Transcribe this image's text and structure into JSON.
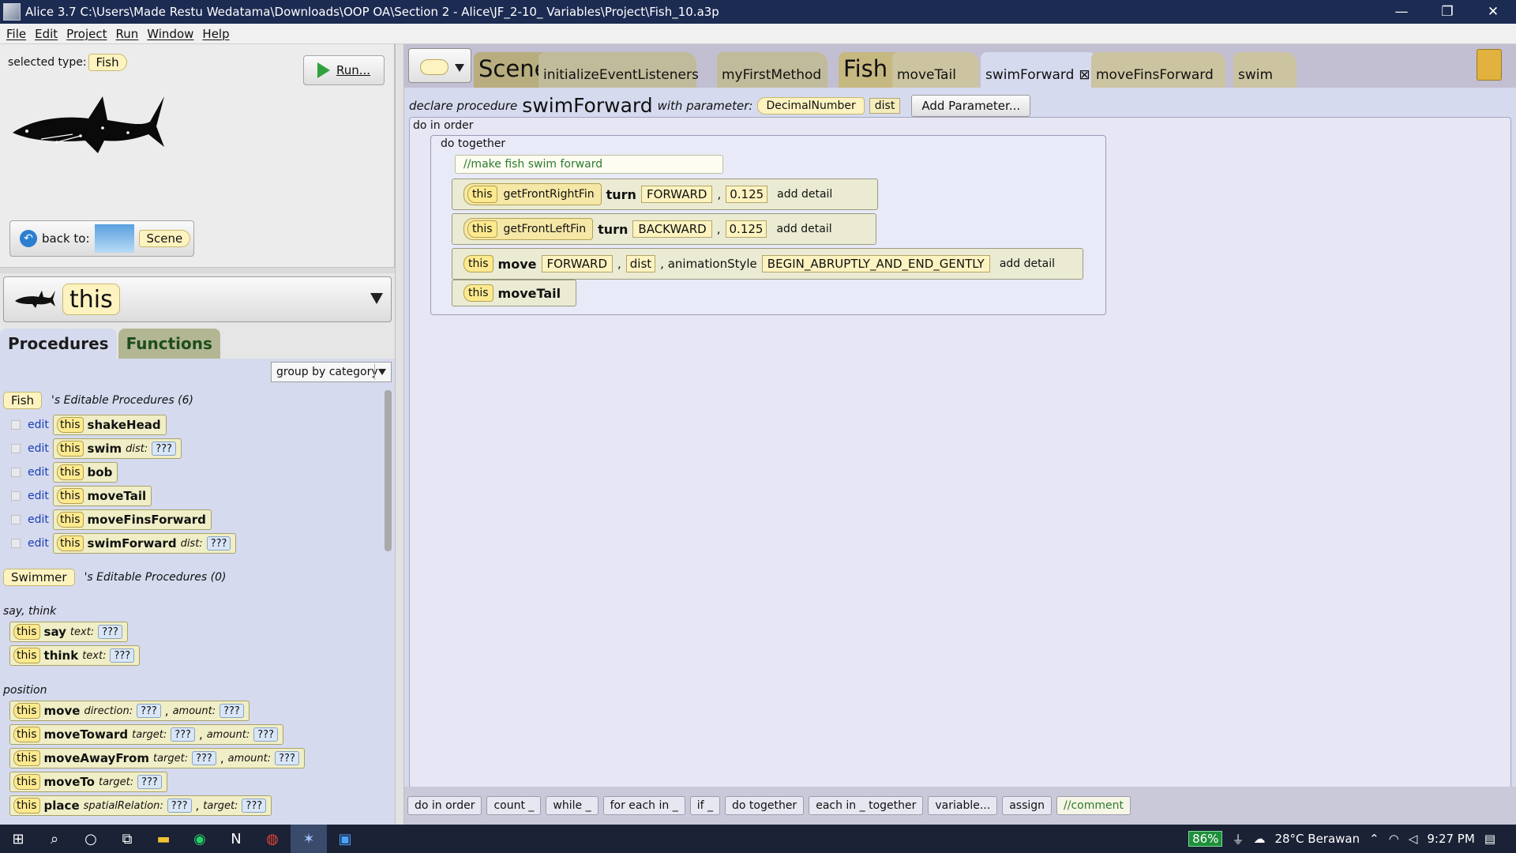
{
  "window": {
    "title": "Alice 3.7 C:\\Users\\Made Restu Wedatama\\Downloads\\OOP OA\\Section 2 - Alice\\JF_2-10_ Variables\\Project\\Fish_10.a3p",
    "min": "—",
    "max": "❐",
    "close": "✕"
  },
  "menu": [
    "File",
    "Edit",
    "Project",
    "Run",
    "Window",
    "Help"
  ],
  "left_top": {
    "selected_type_label": "selected type:",
    "selected_type": "Fish",
    "run_label": "Run...",
    "back_to_label": "back to:",
    "back_to_target": "Scene"
  },
  "instance": {
    "name": "this"
  },
  "left_tabs": {
    "procedures": "Procedures",
    "functions": "Functions"
  },
  "group_by": "group by category",
  "fish_header": {
    "type": "Fish",
    "label": "'s Editable Procedures (6)"
  },
  "fish_procs": [
    {
      "edit": "edit",
      "this": "this",
      "name": "shakeHead"
    },
    {
      "edit": "edit",
      "this": "this",
      "name": "swim",
      "param": "dist:",
      "val": "???"
    },
    {
      "edit": "edit",
      "this": "this",
      "name": "bob"
    },
    {
      "edit": "edit",
      "this": "this",
      "name": "moveTail"
    },
    {
      "edit": "edit",
      "this": "this",
      "name": "moveFinsForward"
    },
    {
      "edit": "edit",
      "this": "this",
      "name": "swimForward",
      "param": "dist:",
      "val": "???"
    }
  ],
  "swimmer_header": {
    "type": "Swimmer",
    "label": "'s Editable Procedures (0)"
  },
  "cat_say": "say, think",
  "say_procs": [
    {
      "this": "this",
      "name": "say",
      "p1": "text:",
      "v1": "???"
    },
    {
      "this": "this",
      "name": "think",
      "p1": "text:",
      "v1": "???"
    }
  ],
  "cat_position": "position",
  "pos_procs": [
    {
      "this": "this",
      "name": "move",
      "p1": "direction:",
      "v1": "???",
      "p2": "amount:",
      "v2": "???"
    },
    {
      "this": "this",
      "name": "moveToward",
      "p1": "target:",
      "v1": "???",
      "p2": "amount:",
      "v2": "???"
    },
    {
      "this": "this",
      "name": "moveAwayFrom",
      "p1": "target:",
      "v1": "???",
      "p2": "amount:",
      "v2": "???"
    },
    {
      "this": "this",
      "name": "moveTo",
      "p1": "target:",
      "v1": "???"
    },
    {
      "this": "this",
      "name": "place",
      "p1": "spatialRelation:",
      "v1": "???",
      "p2": "target:",
      "v2": "???"
    }
  ],
  "tabs": {
    "scene": "Scene",
    "scene_methods": [
      "initializeEventListeners",
      "myFirstMethod"
    ],
    "fish": "Fish",
    "fish_methods": [
      "moveTail",
      "swimForward",
      "moveFinsForward",
      "swim"
    ],
    "active_close": "⊠"
  },
  "declare": {
    "prefix": "declare procedure",
    "name": "swimForward",
    "with": "with parameter:",
    "ptype": "DecimalNumber",
    "pname": "dist",
    "add_param": "Add Parameter..."
  },
  "code": {
    "do_in_order": "do in order",
    "do_together": "do together",
    "comment": "//make fish swim forward",
    "stmt1": {
      "this": "this",
      "fn": "getFrontRightFin",
      "verb": "turn",
      "dir": "FORWARD",
      "amt": "0.125",
      "detail": "add detail"
    },
    "stmt2": {
      "this": "this",
      "fn": "getFrontLeftFin",
      "verb": "turn",
      "dir": "BACKWARD",
      "amt": "0.125",
      "detail": "add detail"
    },
    "stmt3": {
      "this": "this",
      "verb": "move",
      "dir": "FORWARD",
      "amt": "dist",
      "style_label": ", animationStyle",
      "style": "BEGIN_ABRUPTLY_AND_END_GENTLY",
      "detail": "add detail"
    },
    "stmt4": {
      "this": "this",
      "verb": "moveTail"
    }
  },
  "palette": [
    "do in order",
    "count _",
    "while _",
    "for each in _",
    "if _",
    "do together",
    "each in _ together",
    "variable...",
    "assign",
    "//comment"
  ],
  "taskbar": {
    "battery": "86%",
    "weather": "28°C  Berawan",
    "time": "9:27 PM"
  }
}
